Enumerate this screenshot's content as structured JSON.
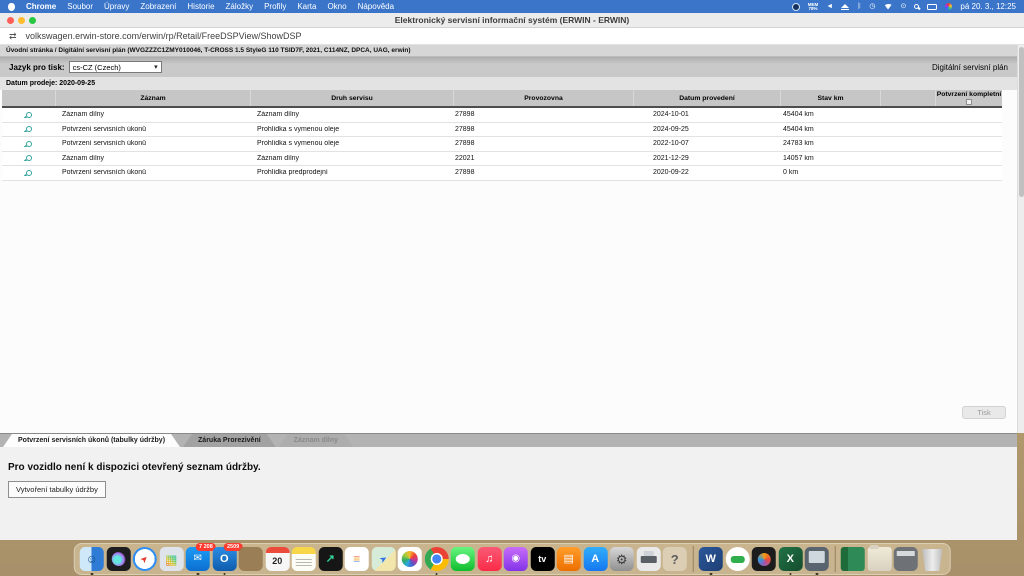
{
  "menu_bar": {
    "items": [
      "Chrome",
      "Soubor",
      "Úpravy",
      "Zobrazení",
      "Historie",
      "Záložky",
      "Profily",
      "Karta",
      "Okno",
      "Nápověda"
    ],
    "status": {
      "mem_label": "MEM",
      "mem_value": "78%",
      "mute_glyph": "◄",
      "bluetooth_glyph": "ᛒ",
      "clock_glyph": "◷",
      "user_glyph": "⊙",
      "clock_text": "pá 20. 3., 12:25"
    }
  },
  "window": {
    "title": "Elektronický servisní informační systém (ERWIN - ERWIN)"
  },
  "browser": {
    "tab_icon": "⇄",
    "url": "volkswagen.erwin-store.com/erwin/rp/Retail/FreeDSPView/ShowDSP"
  },
  "breadcrumb": "Úvodní stránka / Digitální servisní plán (WVGZZZC1ZMY010046, T-CROSS 1.5 StyleG 110 TSID7F, 2021, C114NZ, DPCA, UAG, erwin)",
  "toolbar": {
    "language_label": "Jazyk pro tisk:",
    "language_value": "cs-CZ (Czech)",
    "language_arrow": "▾",
    "plan_title": "Digitální servisní plán",
    "sale_date": "Datum prodeje: 2020-09-25"
  },
  "table": {
    "headers": {
      "zaznam": "Záznam",
      "druh": "Druh servisu",
      "provozovna": "Provozovna",
      "datum": "Datum provedení",
      "stav": "Stav km",
      "potvrzeni": "Potvrzení kompletní"
    },
    "rows": [
      {
        "zaznam": "Záznam dílny",
        "druh": "Záznam dílny",
        "provozovna": "27898",
        "datum": "2024-10-01",
        "stav": "45404 km"
      },
      {
        "zaznam": "Potvrzení servisních úkonů",
        "druh": "Prohlídka s vymenou oleje",
        "provozovna": "27898",
        "datum": "2024-09-25",
        "stav": "45404 km"
      },
      {
        "zaznam": "Potvrzení servisních úkonů",
        "druh": "Prohlídka s vymenou oleje",
        "provozovna": "27898",
        "datum": "2022-10-07",
        "stav": "24783 km"
      },
      {
        "zaznam": "Záznam dílny",
        "druh": "Záznam dílny",
        "provozovna": "22021",
        "datum": "2021-12-29",
        "stav": "14057 km"
      },
      {
        "zaznam": "Potvrzení servisních úkonů",
        "druh": "Prohlídka predprodejní",
        "provozovna": "27898",
        "datum": "2020-09-22",
        "stav": "0 km"
      }
    ]
  },
  "actions": {
    "print_label": "Tisk"
  },
  "tabs": [
    {
      "label": "Potvrzení servisních úkonů (tabulky údržby)",
      "state": "active"
    },
    {
      "label": "Záruka Prorezivění",
      "state": "inactive"
    },
    {
      "label": "Záznam dílny",
      "state": "disabled"
    }
  ],
  "maintenance": {
    "message": "Pro vozidlo není k dispozici otevřený seznam údržby.",
    "create_button": "Vytvoření tabulky údržby"
  },
  "dock": {
    "items": [
      {
        "name": "finder",
        "glyph": "☺"
      },
      {
        "name": "siri"
      },
      {
        "name": "safari",
        "glyph": "➤"
      },
      {
        "name": "launchpad",
        "glyph": "▦"
      },
      {
        "name": "mail",
        "glyph": "✉",
        "badge": "7 208"
      },
      {
        "name": "outlook",
        "glyph": "O",
        "badge": "2509"
      },
      {
        "name": "dimmed-app"
      },
      {
        "name": "calendar",
        "glyph": "20"
      },
      {
        "name": "notes"
      },
      {
        "name": "stocks",
        "glyph": "↗"
      },
      {
        "name": "reminders",
        "glyph": "≡"
      },
      {
        "name": "maps",
        "glyph": "➤"
      },
      {
        "name": "photos"
      },
      {
        "name": "chrome"
      },
      {
        "name": "messages"
      },
      {
        "name": "music",
        "glyph": "♫"
      },
      {
        "name": "podcasts",
        "glyph": "◉"
      },
      {
        "name": "apple-tv",
        "glyph": "tv"
      },
      {
        "name": "books",
        "glyph": "▤"
      },
      {
        "name": "app-store",
        "glyph": "A"
      },
      {
        "name": "settings",
        "glyph": "⚙"
      },
      {
        "name": "printer"
      },
      {
        "name": "help",
        "glyph": "?"
      },
      {
        "name": "word",
        "glyph": "W"
      },
      {
        "name": "car-app"
      },
      {
        "name": "activity-app"
      },
      {
        "name": "excel",
        "glyph": "X"
      },
      {
        "name": "panel-app"
      },
      {
        "name": "green-stack"
      },
      {
        "name": "folder"
      },
      {
        "name": "scanner"
      },
      {
        "name": "trash"
      }
    ]
  },
  "colors": {
    "menubar_blue": "#3a75ca",
    "table_header_gray": "#c6c6c6",
    "magnifier_teal": "#2fa39a",
    "badge_red": "#ff3b30",
    "traffic_red": "#ff5f57",
    "traffic_yellow": "#febc2e",
    "traffic_green": "#28c840"
  }
}
